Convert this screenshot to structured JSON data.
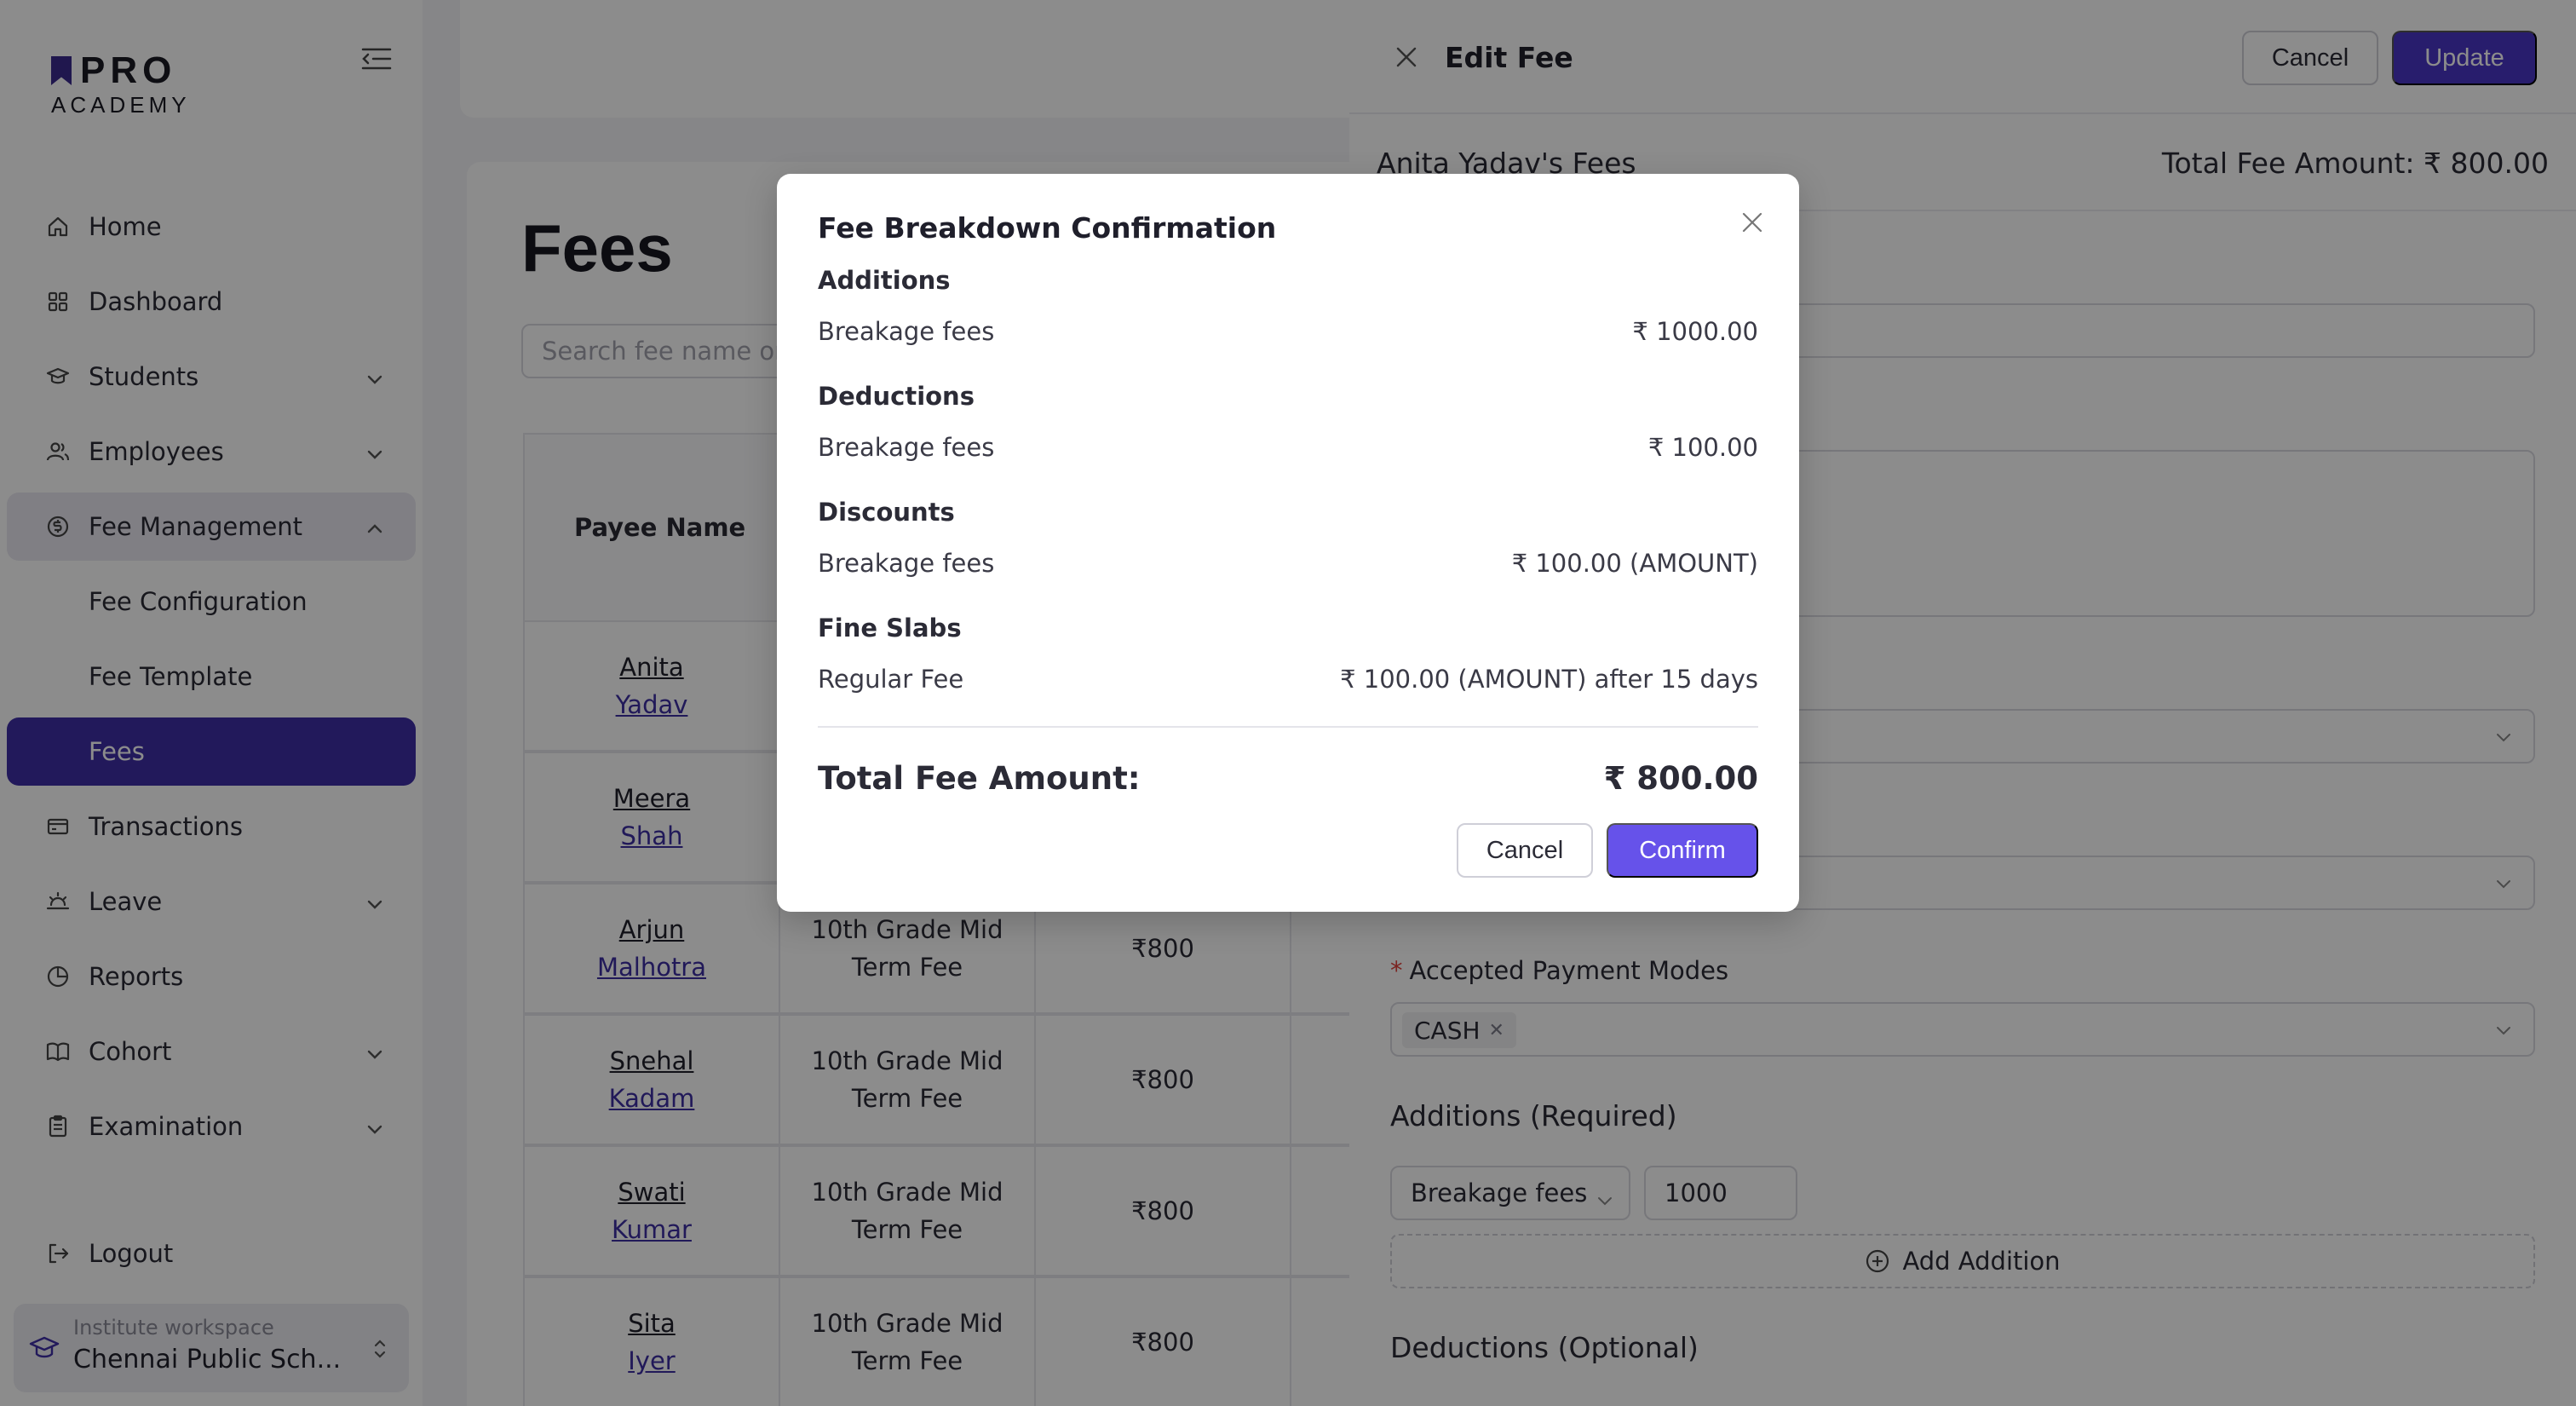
{
  "app": {
    "logo_pro": "PRO",
    "logo_academy": "ACADEMY"
  },
  "sidebar": {
    "items": [
      {
        "label": "Home",
        "icon": "home-icon"
      },
      {
        "label": "Dashboard",
        "icon": "dashboard-icon"
      },
      {
        "label": "Students",
        "icon": "students-icon",
        "has_chevron": true
      },
      {
        "label": "Employees",
        "icon": "employees-icon",
        "has_chevron": true
      },
      {
        "label": "Fee Management",
        "icon": "fee-icon",
        "expanded": true
      },
      {
        "label": "Transactions",
        "icon": "transactions-icon"
      },
      {
        "label": "Leave",
        "icon": "leave-icon",
        "has_chevron": true
      },
      {
        "label": "Reports",
        "icon": "reports-icon"
      },
      {
        "label": "Cohort",
        "icon": "cohort-icon",
        "has_chevron": true
      },
      {
        "label": "Examination",
        "icon": "examination-icon",
        "has_chevron": true
      }
    ],
    "sub_items": [
      {
        "label": "Fee Configuration"
      },
      {
        "label": "Fee Template"
      },
      {
        "label": "Fees",
        "active": true
      }
    ],
    "logout_label": "Logout",
    "workspace": {
      "label": "Institute workspace",
      "name": "Chennai Public Sch..."
    }
  },
  "main": {
    "page_title": "Fees",
    "search_placeholder": "Search fee name or",
    "table": {
      "header_payee": "Payee Name",
      "rows": [
        {
          "first": "Anita",
          "last": "Yadav",
          "template": "",
          "amount": ""
        },
        {
          "first": "Meera",
          "last": "Shah",
          "template": "",
          "amount": ""
        },
        {
          "first": "Arjun",
          "last": "Malhotra",
          "template_l1": "10th Grade Mid",
          "template_l2": "Term Fee",
          "amount": "₹800"
        },
        {
          "first": "Snehal",
          "last": "Kadam",
          "template_l1": "10th Grade Mid",
          "template_l2": "Term Fee",
          "amount": "₹800"
        },
        {
          "first": "Swati",
          "last": "Kumar",
          "template_l1": "10th Grade Mid",
          "template_l2": "Term Fee",
          "amount": "₹800"
        },
        {
          "first": "Sita",
          "last": "Iyer",
          "template_l1": "10th Grade Mid",
          "template_l2": "Term Fee",
          "amount": "₹800"
        }
      ]
    }
  },
  "drawer": {
    "title": "Edit Fee",
    "cancel_label": "Cancel",
    "update_label": "Update",
    "subtitle": "Anita Yadav's Fees",
    "total": "Total Fee Amount: ₹ 800.00",
    "payment_modes_label": "Accepted Payment Modes",
    "payment_tag": "CASH",
    "additions_title": "Additions (Required)",
    "addition_type": "Breakage fees",
    "addition_amount": "1000",
    "add_addition_label": "Add Addition",
    "deductions_title": "Deductions (Optional)"
  },
  "modal": {
    "title": "Fee Breakdown Confirmation",
    "additions_title": "Additions",
    "additions": {
      "label": "Breakage fees",
      "value": "₹ 1000.00"
    },
    "deductions_title": "Deductions",
    "deductions": {
      "label": "Breakage fees",
      "value": "₹ 100.00"
    },
    "discounts_title": "Discounts",
    "discounts": {
      "label": "Breakage fees",
      "value": "₹ 100.00 (AMOUNT)"
    },
    "fine_slabs_title": "Fine Slabs",
    "fine_slabs": {
      "label": "Regular Fee",
      "value": "₹ 100.00 (AMOUNT) after 15 days"
    },
    "total_label": "Total Fee Amount:",
    "total_value": "₹ 800.00",
    "cancel_label": "Cancel",
    "confirm_label": "Confirm"
  },
  "colors": {
    "primary": "#4a36c6",
    "confirm": "#6652ea",
    "active_nav": "#3f2fa6",
    "required": "#e0413b"
  }
}
